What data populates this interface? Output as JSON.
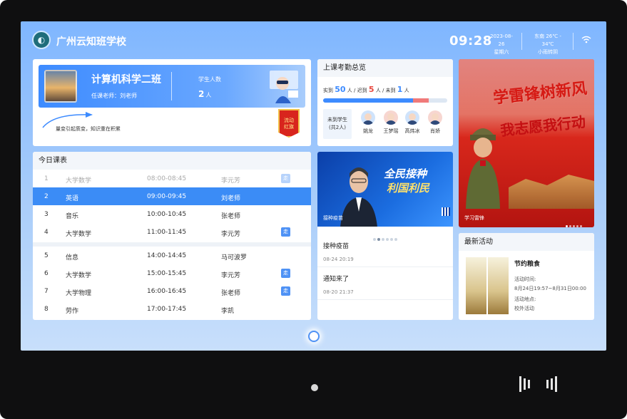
{
  "header": {
    "school": "广州云知班学校",
    "time": "09:28",
    "date": "2023-08-26",
    "weekday": "星期六",
    "wind": "东南",
    "temp": "26℃ - 34℃",
    "weather": "小雨转阴"
  },
  "class_card": {
    "class_name": "计算机科学二班",
    "teacher": "任课老师：刘老师",
    "students_label": "学生人数",
    "students_count": "2",
    "students_unit": "人",
    "motto": "量变引起质变，知识重在积累",
    "flag_line1": "流动",
    "flag_line2": "红旗"
  },
  "schedule": {
    "title": "今日课表",
    "rows": [
      {
        "idx": "1",
        "subject": "大学数学",
        "time": "08:00-08:45",
        "teacher": "李元芳",
        "badge": "走"
      },
      {
        "idx": "2",
        "subject": "英语",
        "time": "09:00-09:45",
        "teacher": "刘老师",
        "badge": ""
      },
      {
        "idx": "3",
        "subject": "音乐",
        "time": "10:00-10:45",
        "teacher": "张老师",
        "badge": ""
      },
      {
        "idx": "4",
        "subject": "大学数学",
        "time": "11:00-11:45",
        "teacher": "李元芳",
        "badge": "走"
      },
      {
        "idx": "5",
        "subject": "信息",
        "time": "14:00-14:45",
        "teacher": "马可波罗",
        "badge": ""
      },
      {
        "idx": "6",
        "subject": "大学数学",
        "time": "15:00-15:45",
        "teacher": "李元芳",
        "badge": "走"
      },
      {
        "idx": "7",
        "subject": "大学物理",
        "time": "16:00-16:45",
        "teacher": "张老师",
        "badge": "走"
      },
      {
        "idx": "8",
        "subject": "劳作",
        "time": "17:00-17:45",
        "teacher": "李凯",
        "badge": ""
      }
    ]
  },
  "attendance": {
    "title": "上课考勤总览",
    "actual_label": "实到",
    "actual": "50",
    "late_label": "人 / 迟到",
    "late": "5",
    "absent_label": "人 / 未到",
    "absent": "1",
    "tail": "人",
    "absent_box_line1": "未到学生",
    "absent_box_line2": "(共2人)",
    "students": [
      "姚龙",
      "王梦瑶",
      "高炜冰",
      "肖娇"
    ]
  },
  "news": {
    "headline1": "全民接种",
    "headline2": "利国利民",
    "image_caption": "接种疫苗",
    "items": [
      {
        "title": "接种疫苗",
        "date": "08-24 20:19"
      },
      {
        "title": "通知来了",
        "date": "08-20 21:37"
      }
    ]
  },
  "poster": {
    "line1": "学雷锋树新风",
    "line2": "我志愿我行动",
    "caption": "学习雷锋"
  },
  "activity": {
    "title": "最新活动",
    "name": "节约粮食",
    "time_label": "活动时间:",
    "time_value": "8月24日19:57~8月31日00:00",
    "place_label": "活动地点:",
    "place_value": "校外活动"
  }
}
